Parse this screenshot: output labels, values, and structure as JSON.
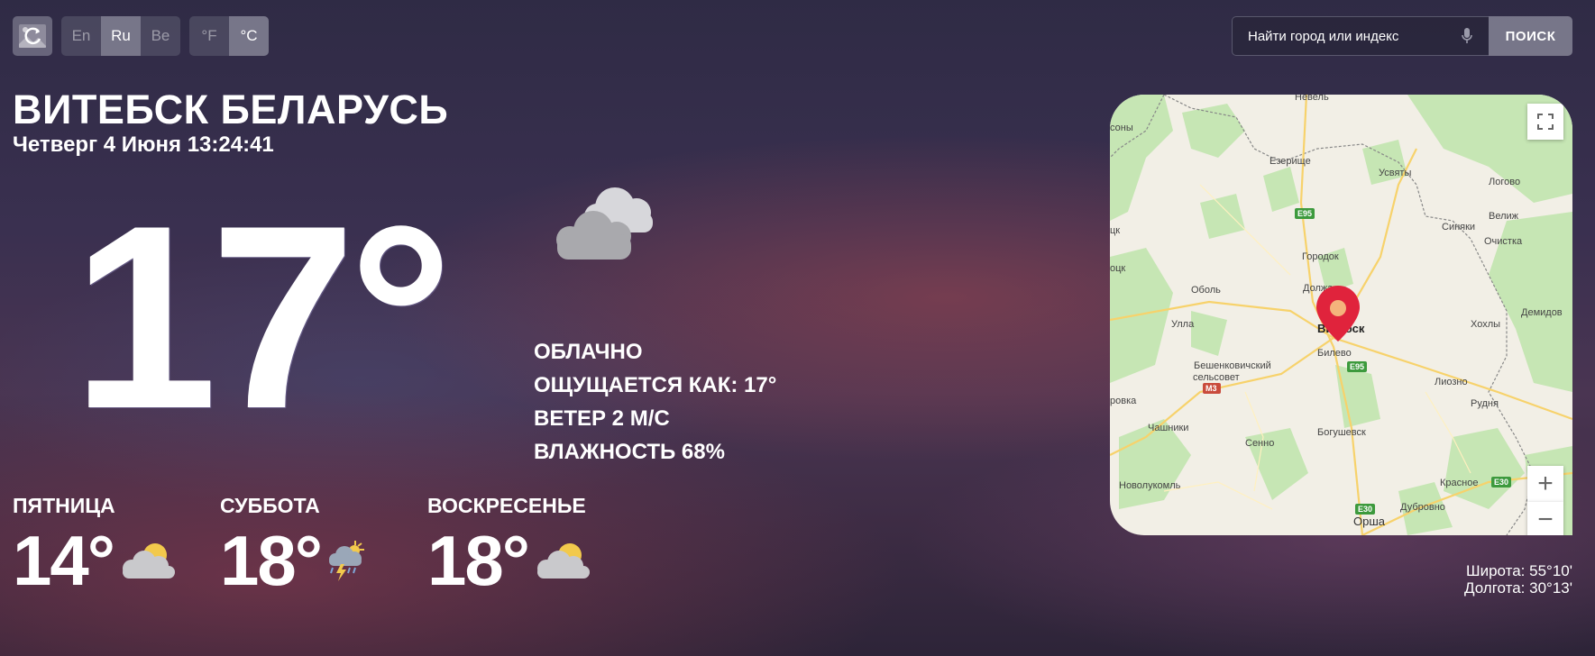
{
  "controls": {
    "refresh_icon": "refresh-image-icon",
    "languages": [
      "En",
      "Ru",
      "Be"
    ],
    "active_language": "Ru",
    "units": [
      "°F",
      "°C"
    ],
    "active_unit": "°C"
  },
  "search": {
    "placeholder": "Найти город или индекс",
    "mic_icon": "microphone-icon",
    "button_label": "ПОИСК"
  },
  "location": {
    "city": "ВИТЕБСК БЕЛАРУСЬ",
    "datetime": "Четверг 4 Июня 13:24:41"
  },
  "current": {
    "temperature": "17°",
    "icon": "cloudy-icon",
    "condition": "ОБЛАЧНО",
    "feels_like": "ОЩУЩАЕТСЯ КАК: 17°",
    "wind": "ВЕТЕР 2 М/С",
    "humidity": "ВЛАЖНОСТЬ 68%"
  },
  "forecast": [
    {
      "day": "ПЯТНИЦА",
      "temp": "14°",
      "icon": "partly-cloudy-icon"
    },
    {
      "day": "СУББОТА",
      "temp": "18°",
      "icon": "thunderstorm-icon"
    },
    {
      "day": "ВОСКРЕСЕНЬЕ",
      "temp": "18°",
      "icon": "partly-cloudy-icon"
    }
  ],
  "map": {
    "labels": {
      "vitebsk": "Витебск",
      "nevel": "Невель",
      "ezerishche": "Езерище",
      "usvyaty": "Усвяты",
      "logovo": "Логово",
      "velizh": "Велиж",
      "sinyaki": "Синяки",
      "ochistka": "Очистка",
      "gorodok": "Городок",
      "dolzha": "Должа",
      "obol": "Оболь",
      "ulla": "Улла",
      "bilevo": "Билево",
      "beshenkovichi": "Бешенковичский",
      "selsovet": "сельсовет",
      "liozno": "Лиозно",
      "rudnya": "Рудня",
      "khokhly": "Хохлы",
      "demidov": "Демидов",
      "chashniki": "Чашники",
      "senno": "Сенно",
      "bogushevsk": "Богушевск",
      "novolukoml": "Новолукомль",
      "krasnoe": "Красное",
      "dubrovno": "Дубровно",
      "orsha": "Орша",
      "sony": "соны",
      "polotsk": "оцк",
      "lovka": "ровка",
      "tsk": "цк"
    },
    "roads": {
      "e95a": "E95",
      "e95b": "E95",
      "m3": "M3",
      "e30a": "E30",
      "e30b": "E30"
    },
    "fullscreen_icon": "fullscreen-icon",
    "zoom_in": "+",
    "zoom_out": "−"
  },
  "coordinates": {
    "latitude": "Широта: 55°10'",
    "longitude": "Долгота: 30°13'"
  },
  "colors": {
    "map_land": "#f2efe6",
    "map_forest": "#c6e6b4",
    "marker": "#e0233c",
    "marker_dot": "#f4b37c"
  }
}
